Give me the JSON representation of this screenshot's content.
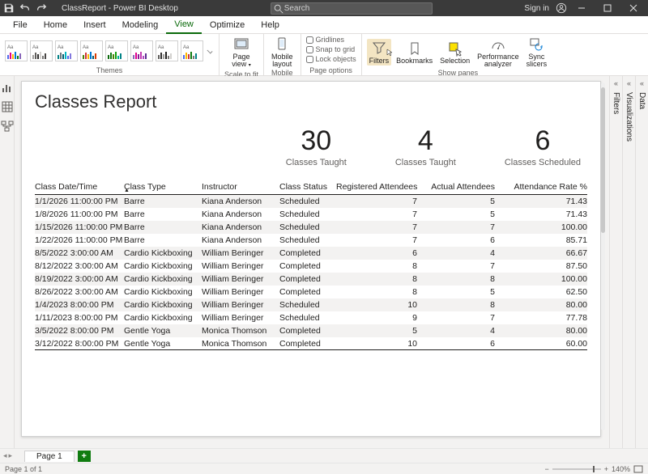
{
  "titlebar": {
    "title": "ClassReport - Power BI Desktop",
    "search_placeholder": "Search",
    "signin": "Sign in"
  },
  "menu_tabs": [
    "File",
    "Home",
    "Insert",
    "Modeling",
    "View",
    "Optimize",
    "Help"
  ],
  "menu_active_index": 4,
  "ribbon": {
    "themes_label": "Themes",
    "page_view": {
      "l1": "Page",
      "l2": "view"
    },
    "scale_label": "Scale to fit",
    "mobile": {
      "l1": "Mobile",
      "l2": "layout"
    },
    "mobile_label": "Mobile",
    "page_options": {
      "gridlines": "Gridlines",
      "snap": "Snap to grid",
      "lock": "Lock objects",
      "label": "Page options"
    },
    "panes": {
      "filters": "Filters",
      "bookmarks": "Bookmarks",
      "selection": "Selection",
      "perf": {
        "l1": "Performance",
        "l2": "analyzer"
      },
      "sync": {
        "l1": "Sync",
        "l2": "slicers"
      },
      "label": "Show panes"
    }
  },
  "right_rails": [
    {
      "label": "Filters"
    },
    {
      "label": "Visualizations"
    },
    {
      "label": "Data"
    }
  ],
  "report": {
    "title": "Classes Report",
    "cards": [
      {
        "num": "30",
        "label": "Classes Taught"
      },
      {
        "num": "4",
        "label": "Classes Taught"
      },
      {
        "num": "6",
        "label": "Classes Scheduled"
      }
    ],
    "columns": [
      "Class Date/Time",
      "Class Type",
      "Instructor",
      "Class Status",
      "Registered Attendees",
      "Actual Attendees",
      "Attendance Rate %"
    ],
    "rows": [
      {
        "dt": "1/1/2026 11:00:00 PM",
        "type": "Barre",
        "inst": "Kiana Anderson",
        "status": "Scheduled",
        "reg": "7",
        "act": "5",
        "rate": "71.43"
      },
      {
        "dt": "1/8/2026 11:00:00 PM",
        "type": "Barre",
        "inst": "Kiana Anderson",
        "status": "Scheduled",
        "reg": "7",
        "act": "5",
        "rate": "71.43"
      },
      {
        "dt": "1/15/2026 11:00:00 PM",
        "type": "Barre",
        "inst": "Kiana Anderson",
        "status": "Scheduled",
        "reg": "7",
        "act": "7",
        "rate": "100.00"
      },
      {
        "dt": "1/22/2026 11:00:00 PM",
        "type": "Barre",
        "inst": "Kiana Anderson",
        "status": "Scheduled",
        "reg": "7",
        "act": "6",
        "rate": "85.71"
      },
      {
        "dt": "8/5/2022 3:00:00 AM",
        "type": "Cardio Kickboxing",
        "inst": "William Beringer",
        "status": "Completed",
        "reg": "6",
        "act": "4",
        "rate": "66.67"
      },
      {
        "dt": "8/12/2022 3:00:00 AM",
        "type": "Cardio Kickboxing",
        "inst": "William Beringer",
        "status": "Completed",
        "reg": "8",
        "act": "7",
        "rate": "87.50"
      },
      {
        "dt": "8/19/2022 3:00:00 AM",
        "type": "Cardio Kickboxing",
        "inst": "William Beringer",
        "status": "Completed",
        "reg": "8",
        "act": "8",
        "rate": "100.00"
      },
      {
        "dt": "8/26/2022 3:00:00 AM",
        "type": "Cardio Kickboxing",
        "inst": "William Beringer",
        "status": "Completed",
        "reg": "8",
        "act": "5",
        "rate": "62.50"
      },
      {
        "dt": "1/4/2023 8:00:00 PM",
        "type": "Cardio Kickboxing",
        "inst": "William Beringer",
        "status": "Scheduled",
        "reg": "10",
        "act": "8",
        "rate": "80.00"
      },
      {
        "dt": "1/11/2023 8:00:00 PM",
        "type": "Cardio Kickboxing",
        "inst": "William Beringer",
        "status": "Scheduled",
        "reg": "9",
        "act": "7",
        "rate": "77.78"
      },
      {
        "dt": "3/5/2022 8:00:00 PM",
        "type": "Gentle Yoga",
        "inst": "Monica Thomson",
        "status": "Completed",
        "reg": "5",
        "act": "4",
        "rate": "80.00"
      },
      {
        "dt": "3/12/2022 8:00:00 PM",
        "type": "Gentle Yoga",
        "inst": "Monica Thomson",
        "status": "Completed",
        "reg": "10",
        "act": "6",
        "rate": "60.00"
      }
    ]
  },
  "pagetab": {
    "label": "Page 1"
  },
  "status": {
    "left": "Page 1 of 1",
    "zoom": "140%"
  }
}
